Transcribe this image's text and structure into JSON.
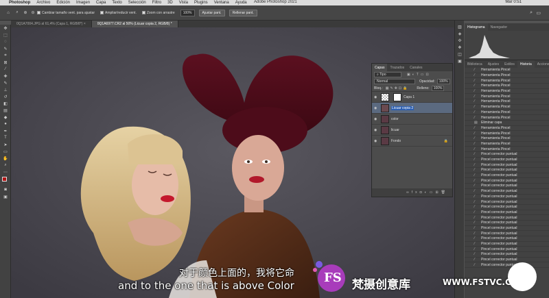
{
  "menubar": {
    "app": "Photoshop",
    "items": [
      "Archivo",
      "Edición",
      "Imagen",
      "Capa",
      "Texto",
      "Selección",
      "Filtro",
      "3D",
      "Vista",
      "Plugins",
      "Ventana",
      "Ayuda"
    ],
    "window_title": "Adobe Photoshop 2021",
    "clock": "Mar 0:51"
  },
  "options": {
    "resize_windows": "Cambiar tamaño vent. para ajustar",
    "zoom_all": "Ampliar/reducir vent.",
    "scrubby_zoom": "Zoom con arrastre",
    "zoom_value": "100%",
    "fit_screen": "Ajustar pant.",
    "fill_screen": "Rellenar pant."
  },
  "doc_tabs": [
    {
      "label": "0Q1A7004.JPG al 61,4% (Capa 1, RGB/8*) ×"
    },
    {
      "label": "0Q1A6977.CR2 al 50% (Licuar copia 2, RGB/8) *"
    }
  ],
  "layers_panel": {
    "tabs": [
      "Capas",
      "Trazados",
      "Canales"
    ],
    "kind": "Tipo",
    "blend": "Normal",
    "opacity_label": "Opacidad:",
    "opacity": "100%",
    "lock_label": "Bloq.:",
    "fill_label": "Relleno:",
    "fill": "100%",
    "layers": [
      {
        "name": "Capa 1",
        "selected": false
      },
      {
        "name": "Licuar copia 2",
        "selected": true
      },
      {
        "name": "color",
        "selected": false
      },
      {
        "name": "licuar",
        "selected": false
      },
      {
        "name": "Fondo",
        "selected": false
      }
    ]
  },
  "histogram_panel": {
    "tabs": [
      "Histograma",
      "Navegador"
    ]
  },
  "history_panel": {
    "tabs": [
      "Biblioteca",
      "Ajustes",
      "Estilos",
      "Historia",
      "Acciones"
    ],
    "items": [
      "Herramienta Pincel",
      "Herramienta Pincel",
      "Herramienta Pincel",
      "Herramienta Pincel",
      "Herramienta Pincel",
      "Herramienta Pincel",
      "Herramienta Pincel",
      "Herramienta Pincel",
      "Herramienta Pincel",
      "Herramienta Pincel",
      "Eliminar capa",
      "Herramienta Pincel",
      "Herramienta Pincel",
      "Herramienta Pincel",
      "Herramienta Pincel",
      "Herramienta Pincel",
      "Pincel corrector puntual",
      "Pincel corrector puntual",
      "Pincel corrector puntual",
      "Pincel corrector puntual",
      "Pincel corrector puntual",
      "Pincel corrector puntual",
      "Pincel corrector puntual",
      "Pincel corrector puntual",
      "Pincel corrector puntual",
      "Pincel corrector puntual",
      "Pincel corrector puntual",
      "Pincel corrector puntual",
      "Pincel corrector puntual",
      "Pincel corrector puntual",
      "Pincel corrector puntual",
      "Pincel corrector puntual",
      "Pincel corrector puntual",
      "Pincel corrector puntual",
      "Pincel corrector puntual",
      "Pincel corrector puntual",
      "Pincel corrector puntual",
      "Pincel corrector puntual"
    ]
  },
  "subtitles": {
    "chinese": "对于颜色上面的，我将它命",
    "english": "and to the one that is above Color"
  },
  "watermark": {
    "brand": "梵摄创意库",
    "url": "WWW.FSTVC.CC",
    "logo": "FS"
  }
}
